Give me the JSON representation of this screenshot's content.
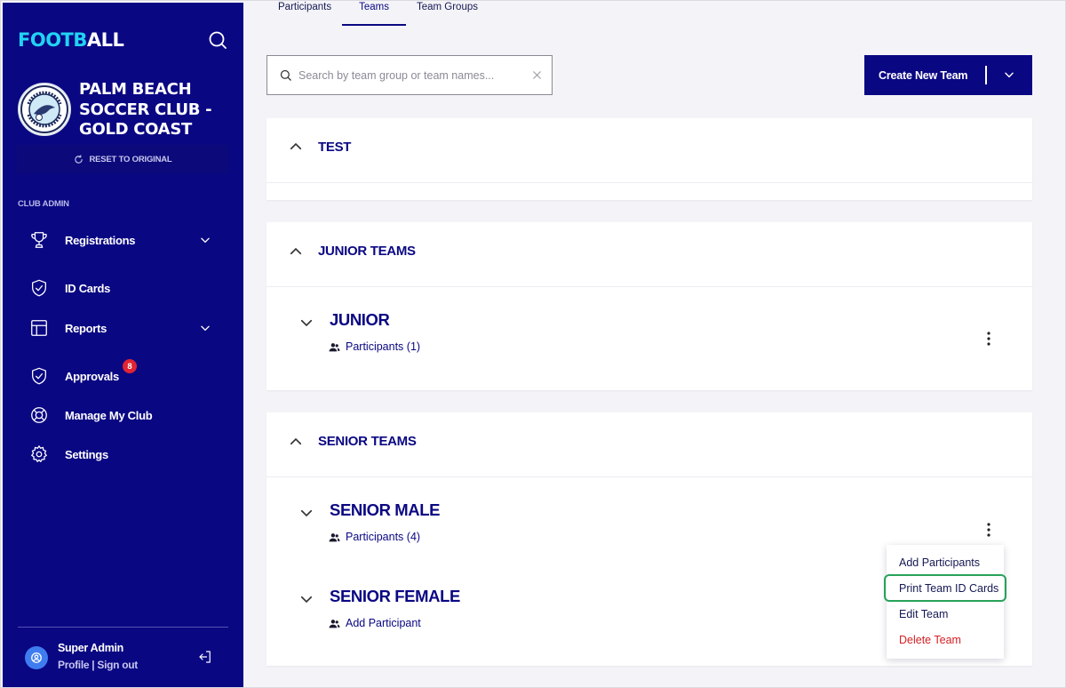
{
  "app": {
    "logo_part1": "FOOTB",
    "logo_part2": "ALL"
  },
  "club": {
    "name": "PALM BEACH SOCCER CLUB - GOLD COAST",
    "reset_label": "RESET TO ORIGINAL"
  },
  "sidebar": {
    "section_label": "CLUB ADMIN",
    "items": [
      {
        "label": "Registrations",
        "icon": "trophy-icon",
        "has_chevron": true
      },
      {
        "label": "ID Cards",
        "icon": "shield-check-icon",
        "has_chevron": false
      },
      {
        "label": "Reports",
        "icon": "table-icon",
        "has_chevron": true
      },
      {
        "label": "Approvals",
        "icon": "shield-check-icon",
        "has_chevron": false,
        "badge": "8"
      },
      {
        "label": "Manage My Club",
        "icon": "lifebuoy-icon",
        "has_chevron": false
      },
      {
        "label": "Settings",
        "icon": "gear-icon",
        "has_chevron": false
      }
    ]
  },
  "user": {
    "name": "Super Admin",
    "profile_label": "Profile",
    "separator": "|",
    "signout_label": "Sign out"
  },
  "tabs": [
    {
      "label": "Participants",
      "active": false
    },
    {
      "label": "Teams",
      "active": true
    },
    {
      "label": "Team Groups",
      "active": false
    }
  ],
  "search": {
    "placeholder": "Search by team group or team names...",
    "value": ""
  },
  "create_button": {
    "label": "Create New Team"
  },
  "groups": [
    {
      "title": "TEST",
      "teams": []
    },
    {
      "title": "JUNIOR TEAMS",
      "teams": [
        {
          "name": "JUNIOR",
          "link": "Participants (1)"
        }
      ]
    },
    {
      "title": "SENIOR TEAMS",
      "teams": [
        {
          "name": "SENIOR MALE",
          "link": "Participants (4)"
        },
        {
          "name": "SENIOR FEMALE",
          "link": "Add Participant"
        }
      ]
    }
  ],
  "context_menu": {
    "items": [
      {
        "label": "Add Participants"
      },
      {
        "label": "Print Team ID Cards",
        "highlighted": true
      },
      {
        "label": "Edit Team"
      },
      {
        "label": "Delete Team",
        "danger": true
      }
    ]
  },
  "colors": {
    "brand_navy": "#0a0783",
    "logo_cyan": "#21d3f3",
    "badge_red": "#e02434",
    "delete_red": "#d42024",
    "highlight_green": "#27a35a"
  }
}
